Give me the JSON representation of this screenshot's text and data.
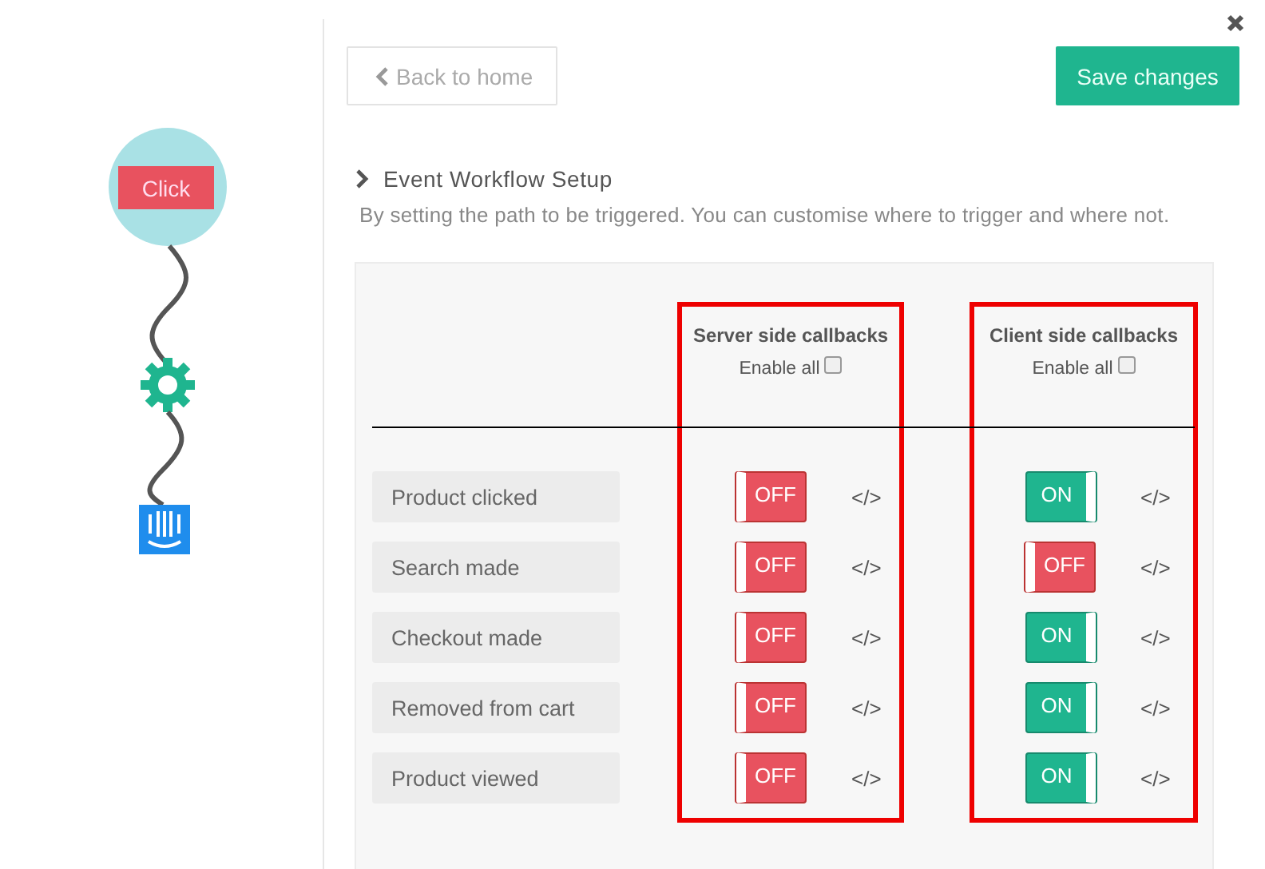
{
  "flow": {
    "trigger": {
      "label": "Click"
    }
  },
  "toolbar": {
    "back_button": {
      "label": "Back to home"
    },
    "save_button": {
      "label": "Save changes"
    }
  },
  "section": {
    "title": "Event Workflow Setup",
    "description": "By setting the path to be triggered. You can customise where to trigger and where not."
  },
  "table": {
    "columns": [
      {
        "title": "Server side callbacks",
        "enable_all": {
          "label": "Enable all",
          "checked": false
        }
      },
      {
        "title": "Client side callbacks",
        "enable_all": {
          "label": "Enable all",
          "checked": false
        }
      }
    ],
    "rows": [
      {
        "label": "Product clicked",
        "toggles": [
          {
            "label": "OFF",
            "on": false,
            "code": "</>"
          },
          {
            "label": "ON",
            "on": true,
            "code": "</>"
          }
        ]
      },
      {
        "label": "Search made",
        "toggles": [
          {
            "label": "OFF",
            "on": false,
            "code": "</>"
          },
          {
            "label": "OFF",
            "on": false,
            "code": "</>"
          }
        ]
      },
      {
        "label": "Checkout made",
        "toggles": [
          {
            "label": "OFF",
            "on": false,
            "code": "</>"
          },
          {
            "label": "ON",
            "on": true,
            "code": "</>"
          }
        ]
      },
      {
        "label": "Removed from cart",
        "toggles": [
          {
            "label": "OFF",
            "on": false,
            "code": "</>"
          },
          {
            "label": "ON",
            "on": true,
            "code": "</>"
          }
        ]
      },
      {
        "label": "Product viewed",
        "toggles": [
          {
            "label": "OFF",
            "on": false,
            "code": "</>"
          },
          {
            "label": "ON",
            "on": true,
            "code": "</>"
          }
        ]
      }
    ]
  }
}
